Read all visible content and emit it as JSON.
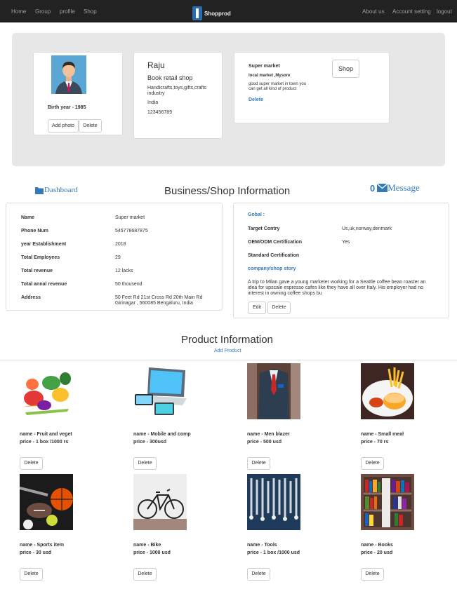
{
  "nav": {
    "left": [
      "Home",
      "Group",
      "profile",
      "Shop"
    ],
    "brand": "Shopprod",
    "right": [
      "About us",
      "Account setting",
      "logout"
    ]
  },
  "profile": {
    "birth_year": "Birth year - 1985",
    "add_photo": "Add photo",
    "delete": "Delete",
    "name": "Raju",
    "shop_type": "Book retail shop",
    "products": "Handicrafts,toys,gifts,crafts industry",
    "country": "India",
    "phone": "123456789",
    "store_name": "Super market",
    "store_loc": "local market ,Mysore",
    "store_desc": "good super market in town you can get all kind of product",
    "store_delete": "Delete",
    "shop_button": "Shop"
  },
  "dashboard": {
    "label": "Dashboard",
    "title": "Business/Shop Information",
    "msg_count": "0",
    "msg_label": "Message"
  },
  "business": [
    {
      "label": "Name",
      "value": "Super market"
    },
    {
      "label": "Phone Num",
      "value": "545778687875"
    },
    {
      "label": "year Establishment",
      "value": "2018"
    },
    {
      "label": "Total Employees",
      "value": "29"
    },
    {
      "label": "Total revenue",
      "value": "12 lacks"
    },
    {
      "label": "Total annal revenue",
      "value": "50 thousend"
    },
    {
      "label": "Address",
      "value": "50 Feet Rd 21st Cross Rd 20th Main Rd Girinagar , 560085 Bengaluru, India"
    }
  ],
  "global": {
    "heading": "Gobal :",
    "target_label": "Target Contry",
    "target_value": "Us,uk,norway,denmark",
    "oem_label": "OEM/ODM Certification",
    "oem_value": "Yes",
    "std_label": "Standard Certification",
    "story_heading": "company/shop story",
    "story": "A trip to Milan gave a young marketer working for a Seattle coffee bean roaster an idea for upscale espresso cafes like they have all over Italy. His employer had no interest in owning coffee shops bu",
    "edit": "Edit",
    "delete": "Delete"
  },
  "products_section": {
    "title": "Product Information",
    "add": "Add Product"
  },
  "products": [
    {
      "name": "name - Fruit and veget",
      "price": "price - 1 box /1000 rs",
      "delete": "Delete",
      "icon": "vegetables-image"
    },
    {
      "name": "name - Mobile and comp",
      "price": "price - 300usd",
      "delete": "Delete",
      "icon": "devices-image"
    },
    {
      "name": "name - Men blazer",
      "price": "price - 500 usd",
      "delete": "Delete",
      "icon": "blazer-image"
    },
    {
      "name": "name - Small meal",
      "price": "price - 70 rs",
      "delete": "Delete",
      "icon": "meal-image"
    },
    {
      "name": "name - Sports item",
      "price": "price - 30 usd",
      "delete": "Delete",
      "icon": "sports-image"
    },
    {
      "name": "name - Bike",
      "price": "price - 1000 usd",
      "delete": "Delete",
      "icon": "bike-image"
    },
    {
      "name": "name - Tools",
      "price": "price - 1 box /1000 usd",
      "delete": "Delete",
      "icon": "tools-image"
    },
    {
      "name": "name - Books",
      "price": "price - 20 usd",
      "delete": "Delete",
      "icon": "books-image"
    }
  ],
  "colors": {
    "navbar": "#222222",
    "link": "#337ab7",
    "jumbo": "#e7e7e7"
  }
}
